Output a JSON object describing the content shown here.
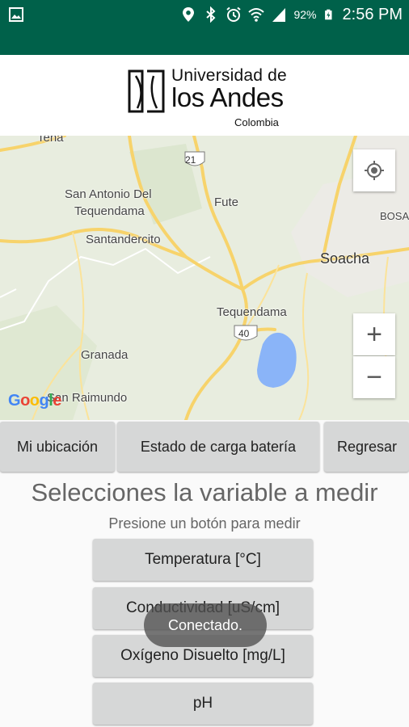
{
  "status_bar": {
    "battery_percent": "92%",
    "time": "2:56 PM",
    "icons": [
      "image-icon",
      "location-icon",
      "bluetooth-icon",
      "alarm-icon",
      "wifi-icon",
      "signal-icon",
      "battery-charging-icon"
    ]
  },
  "logo": {
    "line1": "Universidad de",
    "line2": "los Andes",
    "line3": "Colombia"
  },
  "map": {
    "labels": {
      "tena": "Tena",
      "san_antonio_1": "San Antonio Del",
      "san_antonio_2": "Tequendama",
      "santandercito": "Santandercito",
      "fute": "Fute",
      "soacha": "Soacha",
      "bosa": "BOSA",
      "tequendama": "Tequendama",
      "granada": "Granada",
      "raimundo": "San Raimundo"
    },
    "route_shields": {
      "r21": "21",
      "r40": "40"
    },
    "zoom_in": "+",
    "zoom_out": "−"
  },
  "buttons": {
    "my_location": "Mi ubicación",
    "battery_status": "Estado de carga batería",
    "back": "Regresar"
  },
  "heading": "Selecciones la variable a medir",
  "subheading": "Presione un botón para medir",
  "variables": {
    "temperature": "Temperatura [°C]",
    "conductivity": "Conductividad [uS/cm]",
    "oxygen": "Oxígeno Disuelto [mg/L]",
    "ph": "pH"
  },
  "toast": "Conectado.",
  "colors": {
    "status_bar": "#00614a",
    "button": "#d6d7d7",
    "map_road": "#f7d36b"
  }
}
